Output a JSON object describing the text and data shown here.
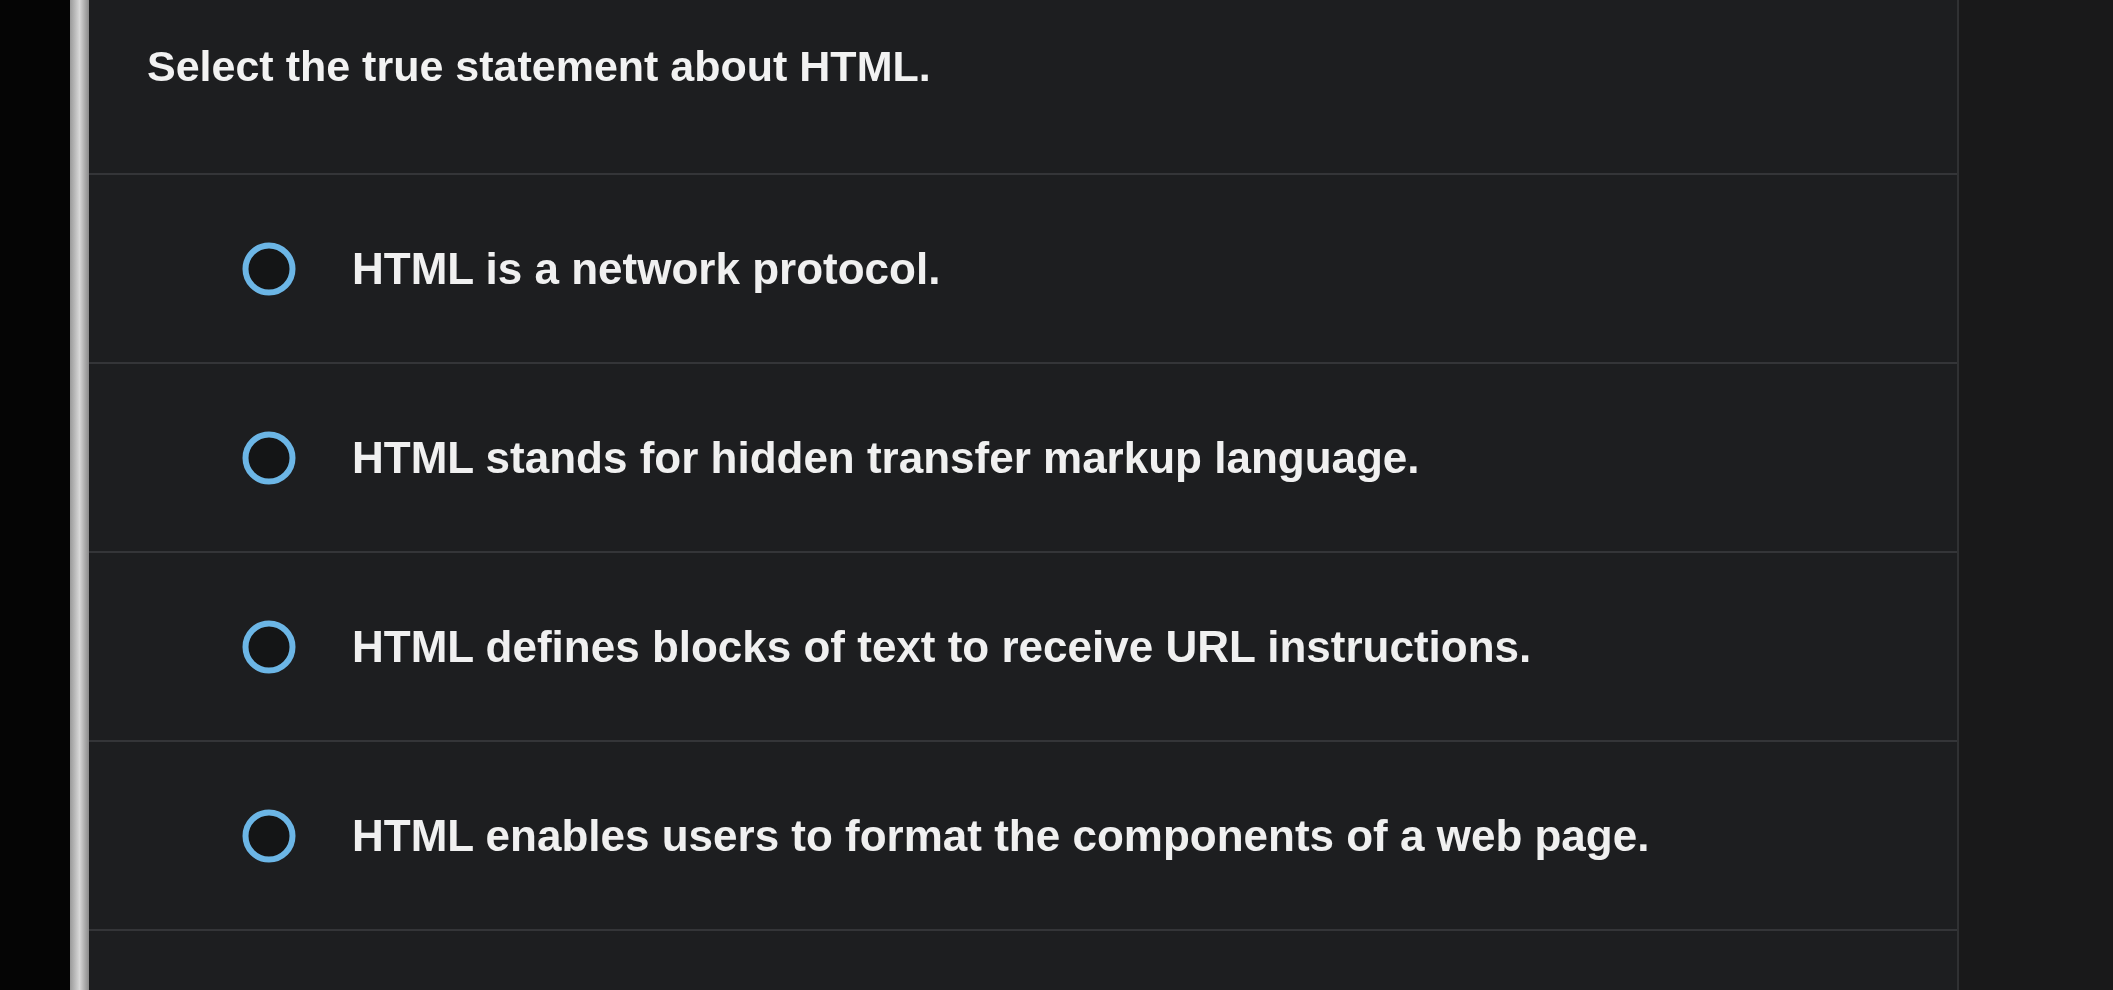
{
  "question": {
    "text": "Select the true statement about HTML."
  },
  "options": [
    {
      "label": "HTML is a network protocol.",
      "selected": false
    },
    {
      "label": "HTML stands for hidden transfer markup language.",
      "selected": false
    },
    {
      "label": "HTML defines blocks of text to receive URL instructions.",
      "selected": false
    },
    {
      "label": "HTML enables users to format the components of a web page.",
      "selected": false
    }
  ]
}
